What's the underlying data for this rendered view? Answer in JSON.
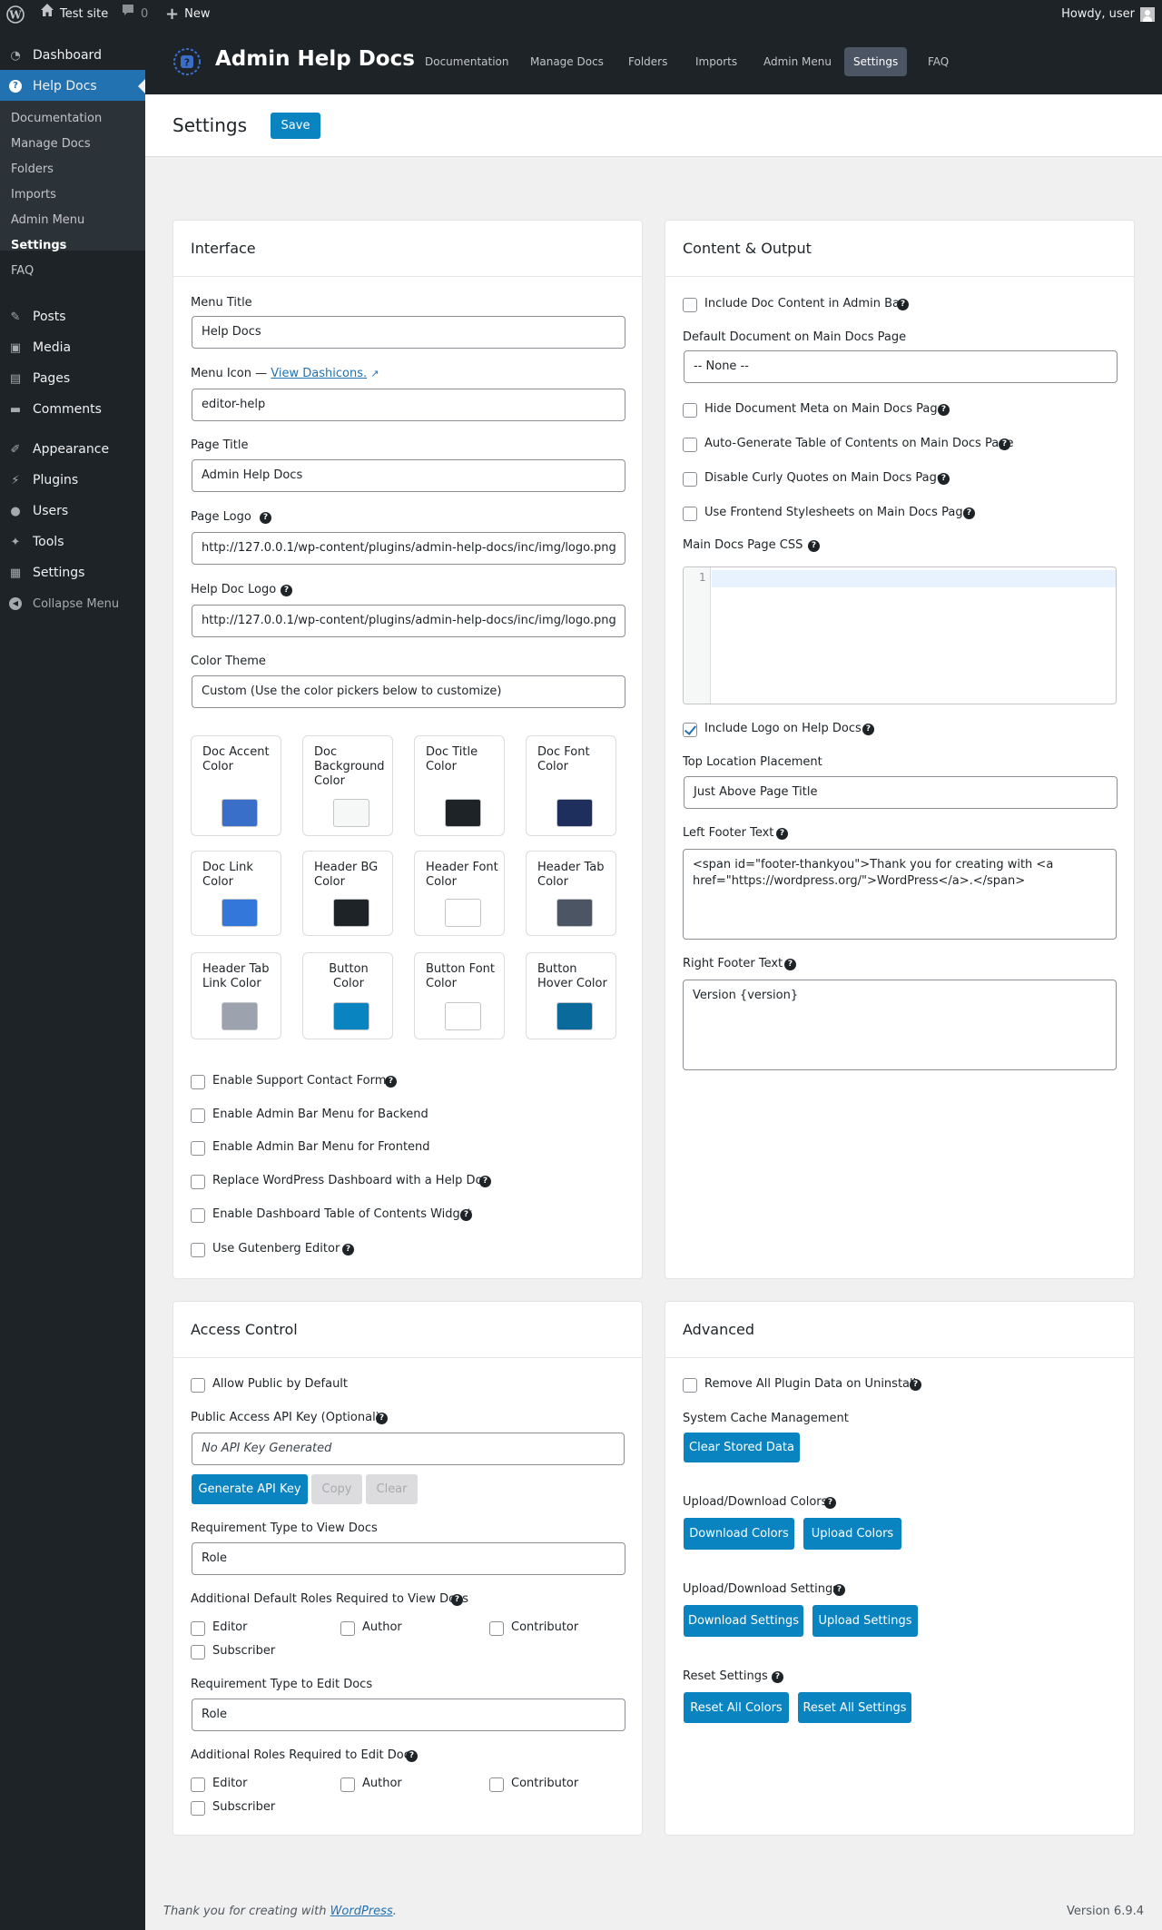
{
  "adminbar": {
    "site": "Test site",
    "comments": "0",
    "new": "New",
    "howdy": "Howdy, user"
  },
  "sidebar": {
    "items": [
      {
        "label": "Dashboard",
        "icon": "dashboard-icon"
      },
      {
        "label": "Help Docs",
        "icon": "help-icon"
      },
      {
        "label": "Posts",
        "icon": "posts-icon"
      },
      {
        "label": "Media",
        "icon": "media-icon"
      },
      {
        "label": "Pages",
        "icon": "pages-icon"
      },
      {
        "label": "Comments",
        "icon": "comments-icon"
      },
      {
        "label": "Appearance",
        "icon": "appearance-icon"
      },
      {
        "label": "Plugins",
        "icon": "plugins-icon"
      },
      {
        "label": "Users",
        "icon": "users-icon"
      },
      {
        "label": "Tools",
        "icon": "tools-icon"
      },
      {
        "label": "Settings",
        "icon": "settings-icon"
      },
      {
        "label": "Collapse Menu",
        "icon": "collapse-icon"
      }
    ],
    "submenu": [
      "Documentation",
      "Manage Docs",
      "Folders",
      "Imports",
      "Admin Menu",
      "Settings",
      "FAQ"
    ]
  },
  "header": {
    "title": "Admin Help Docs",
    "tabs": [
      "Documentation",
      "Manage Docs",
      "Folders",
      "Imports",
      "Admin Menu",
      "Settings",
      "FAQ"
    ],
    "active_tab": "Settings"
  },
  "page": {
    "title": "Settings",
    "save": "Save"
  },
  "interface": {
    "title": "Interface",
    "menu_title_label": "Menu Title",
    "menu_title": "Help Docs",
    "menu_icon_label": "Menu Icon —",
    "menu_icon_link": "View Dashicons.",
    "menu_icon": "editor-help",
    "page_title_label": "Page Title",
    "page_title": "Admin Help Docs",
    "page_logo_label": "Page Logo",
    "page_logo": "http://127.0.0.1/wp-content/plugins/admin-help-docs/inc/img/logo.png",
    "doc_logo_label": "Help Doc Logo",
    "doc_logo": "http://127.0.0.1/wp-content/plugins/admin-help-docs/inc/img/logo.png",
    "color_theme_label": "Color Theme",
    "color_theme": "Custom (Use the color pickers below to customize)",
    "colors": [
      {
        "label": "Doc Accent Color",
        "color": "#3a6fc9"
      },
      {
        "label": "Doc Background Color",
        "color": "#f6f7f7"
      },
      {
        "label": "Doc Title Color",
        "color": "#1d2327"
      },
      {
        "label": "Doc Font Color",
        "color": "#1e2f5e"
      },
      {
        "label": "Doc Link Color",
        "color": "#3477db"
      },
      {
        "label": "Header BG Color",
        "color": "#1d2327"
      },
      {
        "label": "Header Font Color",
        "color": "#ffffff"
      },
      {
        "label": "Header Tab Color",
        "color": "#4b5563"
      },
      {
        "label": "Header Tab Link Color",
        "color": "#9ca3af"
      },
      {
        "label": "Button Color",
        "color": "#0a84c1"
      },
      {
        "label": "Button Font Color",
        "color": "#ffffff"
      },
      {
        "label": "Button Hover Color",
        "color": "#0a6a9b"
      }
    ],
    "checkboxes": [
      {
        "label": "Enable Support Contact Form",
        "help": true
      },
      {
        "label": "Enable Admin Bar Menu for Backend",
        "help": false
      },
      {
        "label": "Enable Admin Bar Menu for Frontend",
        "help": false
      },
      {
        "label": "Replace WordPress Dashboard with a Help Doc",
        "help": true
      },
      {
        "label": "Enable Dashboard Table of Contents Widget",
        "help": true
      },
      {
        "label": "Use Gutenberg Editor",
        "help": true
      }
    ]
  },
  "content": {
    "title": "Content & Output",
    "include_admin_bar": "Include Doc Content in Admin Bar",
    "default_doc_label": "Default Document on Main Docs Page",
    "default_doc": "-- None --",
    "checks": [
      "Hide Document Meta on Main Docs Page",
      "Auto-Generate Table of Contents on Main Docs Page",
      "Disable Curly Quotes on Main Docs Page",
      "Use Frontend Stylesheets on Main Docs Page"
    ],
    "css_label": "Main Docs Page CSS",
    "css_line": "1",
    "include_logo": "Include Logo on Help Docs",
    "top_loc_label": "Top Location Placement",
    "top_loc": "Just Above Page Title",
    "left_footer_label": "Left Footer Text",
    "left_footer": "<span id=\"footer-thankyou\">Thank you for creating with <a href=\"https://wordpress.org/\">WordPress</a>.</span>",
    "right_footer_label": "Right Footer Text",
    "right_footer": "Version {version}"
  },
  "access": {
    "title": "Access Control",
    "allow_public": "Allow Public by Default",
    "api_label": "Public Access API Key (Optional)",
    "api_placeholder": "No API Key Generated",
    "generate": "Generate API Key",
    "copy": "Copy",
    "clear": "Clear",
    "req_view_label": "Requirement Type to View Docs",
    "req_view": "Role",
    "roles_view_label": "Additional Default Roles Required to View Docs",
    "req_edit_label": "Requirement Type to Edit Docs",
    "req_edit": "Role",
    "roles_edit_label": "Additional Roles Required to Edit Docs",
    "roles": [
      "Editor",
      "Author",
      "Contributor",
      "Subscriber"
    ]
  },
  "advanced": {
    "title": "Advanced",
    "remove_data": "Remove All Plugin Data on Uninstall",
    "cache_label": "System Cache Management",
    "clear_data": "Clear Stored Data",
    "colors_label": "Upload/Download Colors",
    "download_colors": "Download Colors",
    "upload_colors": "Upload Colors",
    "settings_label": "Upload/Download Settings",
    "download_settings": "Download Settings",
    "upload_settings": "Upload Settings",
    "reset_label": "Reset Settings",
    "reset_colors": "Reset All Colors",
    "reset_settings": "Reset All Settings"
  },
  "footer": {
    "text": "Thank you for creating with ",
    "link": "WordPress",
    "period": ".",
    "version": "Version 6.9.4"
  },
  "theme": {
    "accent": "#0a84c1",
    "dark": "#1d2327",
    "active_menu": "#2271b1"
  }
}
